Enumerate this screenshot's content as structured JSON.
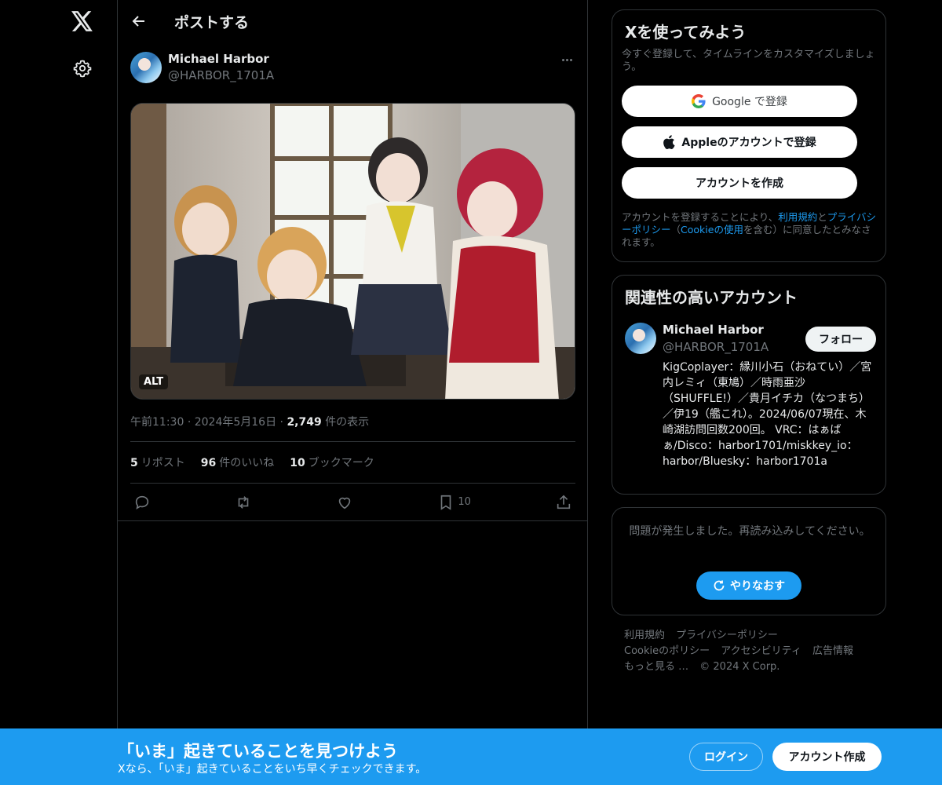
{
  "header": {
    "title": "ポストする"
  },
  "post": {
    "author_name": "Michael Harbor",
    "author_handle": "@HARBOR_1701A",
    "alt_label": "ALT",
    "time": "午前11:30",
    "date": "2024年5月16日",
    "views_count": "2,749",
    "views_label": "件の表示",
    "reposts_count": "5",
    "reposts_label": "リポスト",
    "likes_count": "96",
    "likes_label": "件のいいね",
    "bookmarks_count": "10",
    "bookmarks_label": "ブックマーク",
    "bookmark_action_count": "10"
  },
  "signup_card": {
    "title": "Xを使ってみよう",
    "subtitle": "今すぐ登録して、タイムラインをカスタマイズしましょう。",
    "google_label": "Google で登録",
    "apple_label": "Appleのアカウントで登録",
    "create_label": "アカウントを作成",
    "terms_prefix": "アカウントを登録することにより、",
    "terms_link": "利用規約",
    "terms_and": "と",
    "privacy_link": "プライバシーポリシー",
    "cookie_open": "（",
    "cookie_link": "Cookieの使用",
    "terms_suffix": "を含む）に同意したとみなされます。"
  },
  "related_card": {
    "title": "関連性の高いアカウント",
    "name": "Michael Harbor",
    "handle": "@HARBOR_1701A",
    "follow_label": "フォロー",
    "bio": "KigCoplayer：縁川小石（おねてい）／宮内レミィ（東鳩）／時雨亜沙（SHUFFLE!）／貴月イチカ（なつまち）／伊19（艦これ）。2024/06/07現在、木崎湖訪問回数200回。 VRC：はぁばぁ/Disco：harbor1701/miskkey_io：harbor/Bluesky：harbor1701a"
  },
  "error_card": {
    "message": "問題が発生しました。再読み込みしてください。",
    "retry_label": "やりなおす"
  },
  "footer": {
    "links": [
      "利用規約",
      "プライバシーポリシー",
      "Cookieのポリシー",
      "アクセシビリティ",
      "広告情報",
      "もっと見る …",
      "© 2024 X Corp."
    ]
  },
  "bottom_bar": {
    "title": "「いま」起きていることを見つけよう",
    "subtitle": "Xなら、「いま」起きていることをいち早くチェックできます。",
    "login_label": "ログイン",
    "signup_label": "アカウント作成"
  },
  "colors": {
    "accent": "#1d9bf0",
    "background": "#000000",
    "border": "#2f3336",
    "muted": "#71767b"
  },
  "icons": [
    "x-logo-icon",
    "gear-icon",
    "back-arrow-icon",
    "more-icon",
    "reply-icon",
    "repost-icon",
    "like-icon",
    "bookmark-icon",
    "share-icon",
    "google-icon",
    "apple-icon",
    "refresh-icon"
  ]
}
